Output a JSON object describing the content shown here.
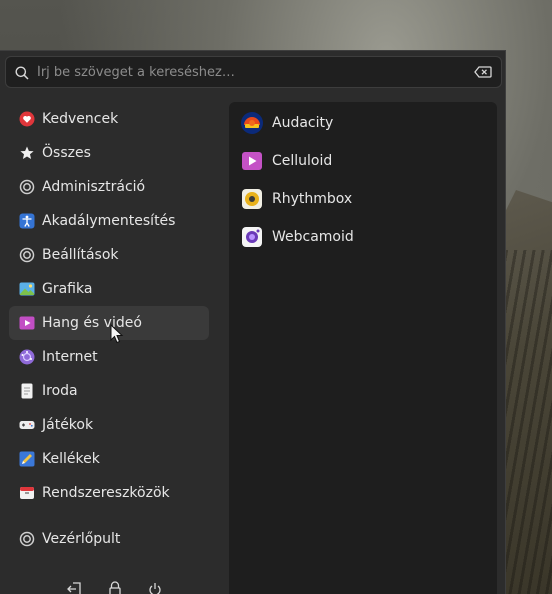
{
  "search": {
    "placeholder": "Írj be szöveget a kereséshez…",
    "value": ""
  },
  "categories": [
    {
      "label": "Kedvencek",
      "icon": "heart-icon"
    },
    {
      "label": "Összes",
      "icon": "star-icon"
    },
    {
      "label": "Adminisztráció",
      "icon": "settings-circle-icon"
    },
    {
      "label": "Akadálymentesítés",
      "icon": "accessibility-icon"
    },
    {
      "label": "Beállítások",
      "icon": "settings-circle-icon"
    },
    {
      "label": "Grafika",
      "icon": "image-icon"
    },
    {
      "label": "Hang és videó",
      "icon": "media-play-icon",
      "selected": true
    },
    {
      "label": "Internet",
      "icon": "globe-icon"
    },
    {
      "label": "Iroda",
      "icon": "document-icon"
    },
    {
      "label": "Játékok",
      "icon": "gamepad-icon"
    },
    {
      "label": "Kellékek",
      "icon": "pencil-icon"
    },
    {
      "label": "Rendszereszközök",
      "icon": "toolbox-icon"
    }
  ],
  "control_center": {
    "label": "Vezérlőpult",
    "icon": "settings-circle-icon"
  },
  "apps": [
    {
      "label": "Audacity",
      "icon": "audacity-icon"
    },
    {
      "label": "Celluloid",
      "icon": "celluloid-icon"
    },
    {
      "label": "Rhythmbox",
      "icon": "rhythmbox-icon"
    },
    {
      "label": "Webcamoid",
      "icon": "webcamoid-icon"
    }
  ],
  "bottom_actions": [
    "logout-icon",
    "lock-icon",
    "power-icon"
  ],
  "colors": {
    "panel": "#2c2c2c",
    "apps_panel": "#1e1e1e",
    "selected": "#3a3a3a",
    "text": "#e6e6e6"
  }
}
